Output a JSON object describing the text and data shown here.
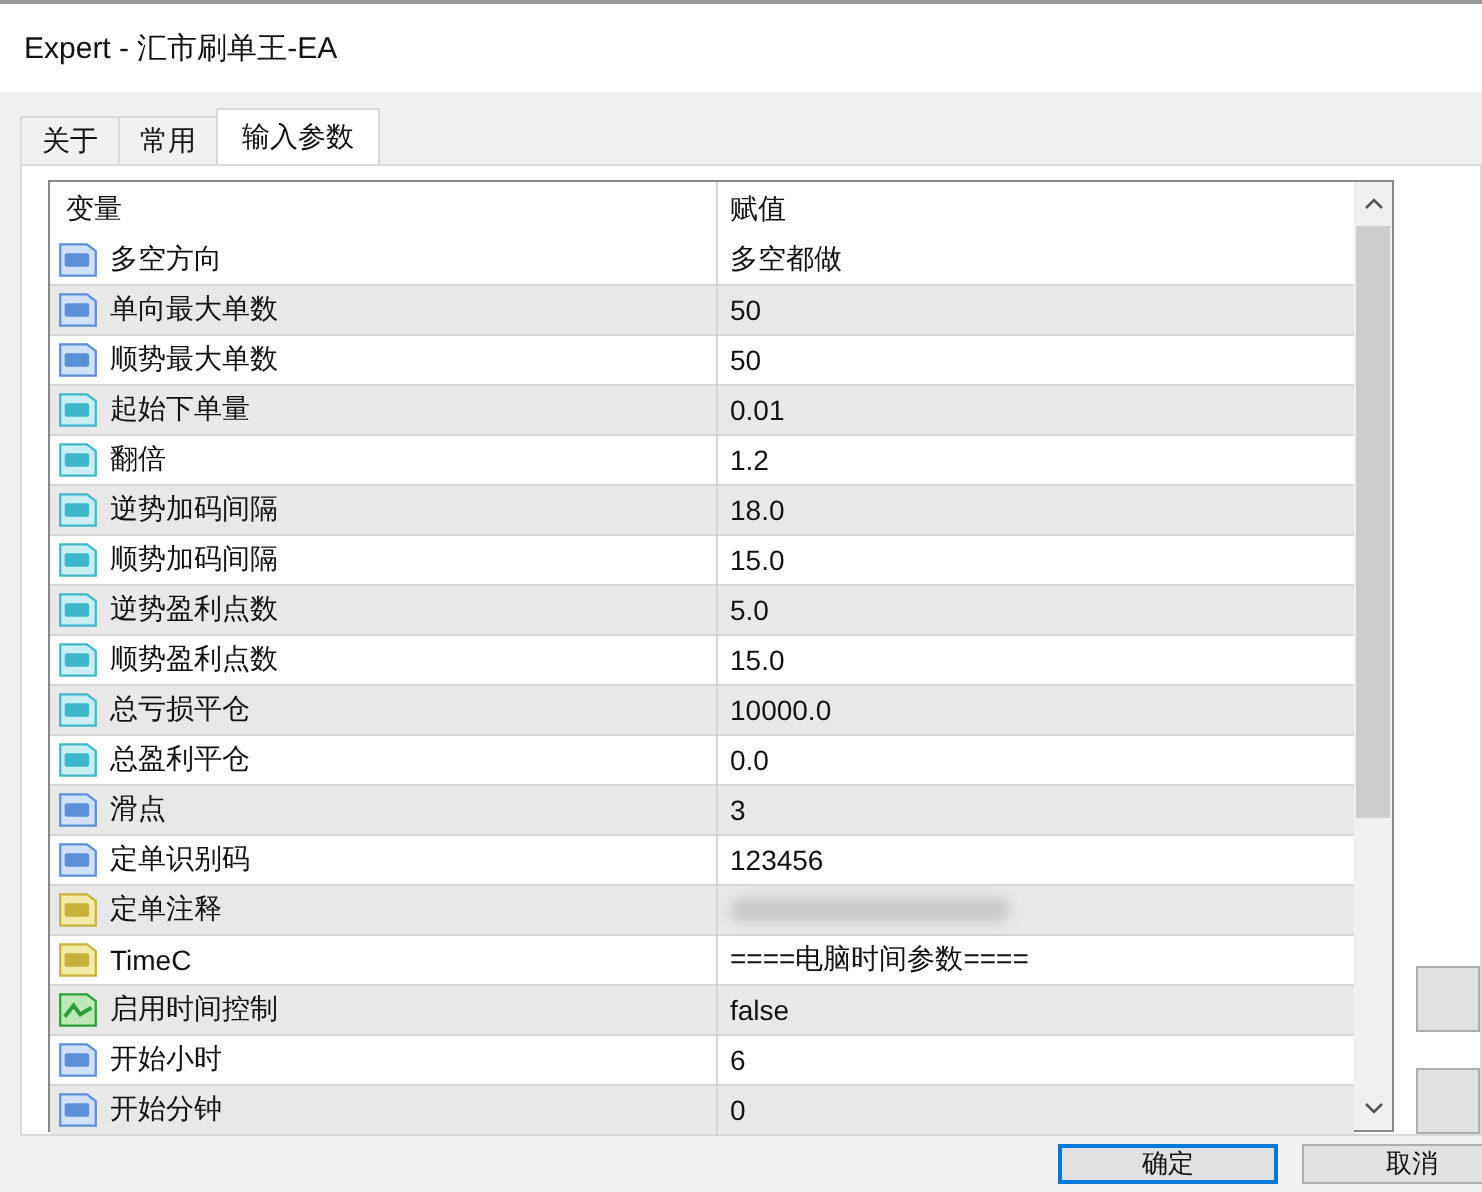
{
  "window": {
    "title": "Expert - 汇市刷单王-EA"
  },
  "tabs": [
    {
      "label": "关于",
      "selected": false
    },
    {
      "label": "常用",
      "selected": false
    },
    {
      "label": "输入参数",
      "selected": true
    }
  ],
  "table": {
    "columns": [
      "变量",
      "赋值"
    ],
    "rows": [
      {
        "kind": "int",
        "name": "多空方向",
        "value": "多空都做"
      },
      {
        "kind": "int",
        "name": "单向最大单数",
        "value": "50"
      },
      {
        "kind": "int",
        "name": "顺势最大单数",
        "value": "50"
      },
      {
        "kind": "double",
        "name": "起始下单量",
        "value": "0.01"
      },
      {
        "kind": "double",
        "name": "翻倍",
        "value": "1.2"
      },
      {
        "kind": "double",
        "name": "逆势加码间隔",
        "value": "18.0"
      },
      {
        "kind": "double",
        "name": "顺势加码间隔",
        "value": "15.0"
      },
      {
        "kind": "double",
        "name": "逆势盈利点数",
        "value": "5.0"
      },
      {
        "kind": "double",
        "name": "顺势盈利点数",
        "value": "15.0"
      },
      {
        "kind": "double",
        "name": "总亏损平仓",
        "value": "10000.0"
      },
      {
        "kind": "double",
        "name": "总盈利平仓",
        "value": "0.0"
      },
      {
        "kind": "int",
        "name": "滑点",
        "value": "3"
      },
      {
        "kind": "int",
        "name": "定单识别码",
        "value": "123456"
      },
      {
        "kind": "string",
        "name": "定单注释",
        "blurred": true
      },
      {
        "kind": "string",
        "name": "TimeC",
        "value": "====电脑时间参数===="
      },
      {
        "kind": "bool",
        "name": "启用时间控制",
        "value": "false"
      },
      {
        "kind": "int",
        "name": "开始小时",
        "value": "6"
      },
      {
        "kind": "int",
        "name": "开始分钟",
        "value": "0"
      }
    ]
  },
  "buttons": [
    {
      "label": "确定",
      "default": true
    },
    {
      "label": "取消",
      "default": false
    }
  ]
}
